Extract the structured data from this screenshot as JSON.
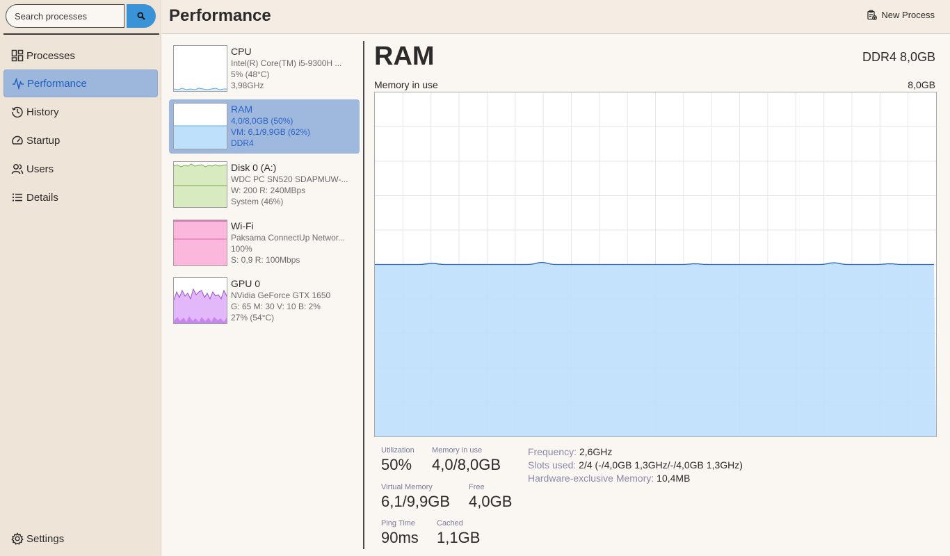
{
  "search": {
    "placeholder": "Search processes"
  },
  "nav": {
    "items": [
      {
        "label": "Processes",
        "icon": "grid-icon"
      },
      {
        "label": "Performance",
        "icon": "pulse-icon",
        "active": true
      },
      {
        "label": "History",
        "icon": "history-icon"
      },
      {
        "label": "Startup",
        "icon": "gauge-icon"
      },
      {
        "label": "Users",
        "icon": "users-icon"
      },
      {
        "label": "Details",
        "icon": "list-icon"
      }
    ],
    "settings": "Settings"
  },
  "header": {
    "title": "Performance",
    "new_process": "New Process"
  },
  "devices": [
    {
      "name": "CPU",
      "l1": "Intel(R) Core(TM) i5-9300H ...",
      "l2": "5% (48°C)",
      "l3": "3,98GHz",
      "color": "#5fa8d8",
      "fill": "#ffffff"
    },
    {
      "name": "RAM",
      "l1": "4,0/8,0GB (50%)",
      "l2": "VM: 6,1/9,9GB (62%)",
      "l3": "DDR4",
      "color": "#5fa8d8",
      "fill": "#bfe0fb",
      "active": true
    },
    {
      "name": "Disk 0 (A:)",
      "l1": "WDC PC SN520 SDAPMUW-...",
      "l2": "W: 200 R: 240MBps",
      "l3": "System (46%)",
      "color": "#7aa84a",
      "fill": "#d8eabf"
    },
    {
      "name": "Wi-Fi",
      "l1": "Paksama ConnectUp Networ...",
      "l2": "100%",
      "l3": "S: 0,9 R: 100Mbps",
      "color": "#d866a8",
      "fill": "#fbb8dc"
    },
    {
      "name": "GPU 0",
      "l1": "NVidia GeForce GTX 1650",
      "l2": "G: 65 M: 30 V: 10 B: 2%",
      "l3": "27% (54°C)",
      "color": "#9a4fd0",
      "fill": "#e3b8fb"
    }
  ],
  "detail": {
    "title": "RAM",
    "subtitle": "DDR4 8,0GB",
    "graph_label": "Memory in use",
    "graph_max": "8,0GB",
    "usage_fraction": 0.5,
    "colors": {
      "line": "#2a62c9",
      "fill": "#bfe0fb",
      "grid": "#e6e6ea"
    }
  },
  "stats": {
    "utilization": {
      "label": "Utilization",
      "value": "50%"
    },
    "memory_in_use": {
      "label": "Memory in use",
      "value": "4,0/8,0GB"
    },
    "virtual_memory": {
      "label": "Virtual Memory",
      "value": "6,1/9,9GB"
    },
    "free": {
      "label": "Free",
      "value": "4,0GB"
    },
    "ping_time": {
      "label": "Ping Time",
      "value": "90ms"
    },
    "cached": {
      "label": "Cached",
      "value": "1,1GB"
    }
  },
  "properties": {
    "frequency": {
      "label": "Frequency:",
      "value": "2,6GHz"
    },
    "slots_used": {
      "label": "Slots used:",
      "value": "2/4 (-/4,0GB 1,3GHz/-/4,0GB 1,3GHz)"
    },
    "hw_exclusive": {
      "label": "Hardware-exclusive Memory:",
      "value": "10,4MB"
    }
  }
}
